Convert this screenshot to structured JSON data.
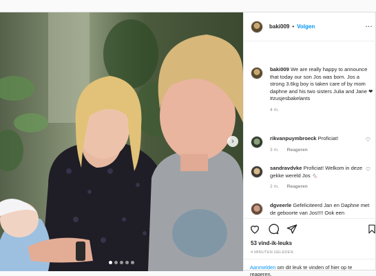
{
  "post": {
    "username": "baki009",
    "separator": "•",
    "follow_label": "Volgen",
    "more_label": "…",
    "caption": {
      "username": "baki009",
      "text": "We are really happy to announce that today our son Jos was born. Jos a strong 3.6kg boy is taken care of by mom daphne and his two sisters Julia and Jane ❤ #zusjesbakelants",
      "time": "4 m."
    },
    "comments": [
      {
        "username": "rikvanpuymbroeck",
        "text": "Proficiat!",
        "time": "",
        "reply_label": ""
      },
      {
        "username": "sandravdvke",
        "text": "Proficiat! Welkom in deze gekke wereld Jos 🐁",
        "time": "2 m.",
        "reply_label": "Reageren"
      },
      {
        "username": "dgveerle",
        "text": "Gefeliciteerd Jan en Daphne met de geboorte van Jos!!!! Ook een",
        "time": "",
        "reply_label": ""
      }
    ],
    "comment1_meta": {
      "time": "3 m.",
      "reply_label": "Reageren"
    },
    "likes_text": "53 vind-ik-leuks",
    "posted_time": "4 MINUTEN GELEDEN",
    "login_link": "Aanmelden",
    "login_text": " om dit leuk te vinden of hier op te reageren.",
    "carousel": {
      "count": 5,
      "active_index": 0,
      "next_icon": "›"
    },
    "icons": [
      "heart-icon",
      "comment-icon",
      "share-icon",
      "bookmark-icon"
    ]
  }
}
